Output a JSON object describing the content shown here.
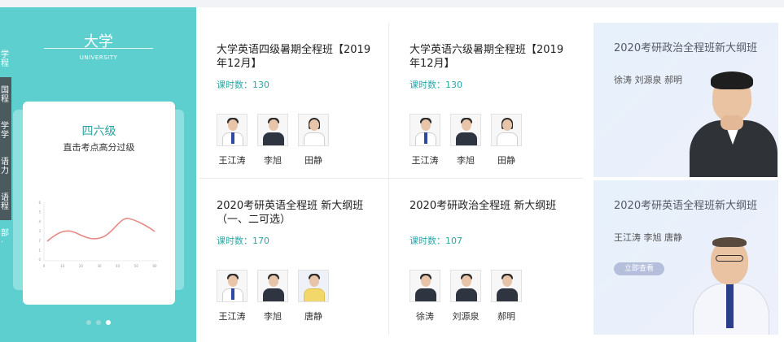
{
  "left_panel": {
    "title": "大学",
    "subtitle": "UNIVERSITY",
    "side_tabs": [
      "学程",
      "国程",
      "学学",
      "语力",
      "语程",
      "部·"
    ],
    "card": {
      "title": "四六级",
      "subtitle": "直击考点高分过级",
      "chart_ticks_x": [
        "0",
        "10",
        "20",
        "30",
        "40",
        "50",
        "60"
      ],
      "chart_ticks_y": [
        "6",
        "5",
        "4",
        "3",
        "2",
        "1",
        "0"
      ]
    },
    "carousel_dots": 3,
    "carousel_active": 3
  },
  "courses": [
    {
      "title": "大学英语四级暑期全程班【2019年12月】",
      "hours_label": "课时数：",
      "hours": "130",
      "teachers": [
        "王江涛",
        "李旭",
        "田静"
      ]
    },
    {
      "title": "大学英语六级暑期全程班【2019年12月】",
      "hours_label": "课时数：",
      "hours": "130",
      "teachers": [
        "王江涛",
        "李旭",
        "田静"
      ]
    },
    {
      "title": "2020考研英语全程班 新大纲班（一、二可选）",
      "hours_label": "课时数：",
      "hours": "170",
      "teachers": [
        "王江涛",
        "李旭",
        "唐静"
      ]
    },
    {
      "title": "2020考研政治全程班 新大纲班",
      "hours_label": "课时数：",
      "hours": "107",
      "teachers": [
        "徐涛",
        "刘源泉",
        "郝明"
      ]
    }
  ],
  "promos": [
    {
      "title": "2020考研政治全程班新大纲班",
      "teachers": "徐涛 刘源泉 郝明"
    },
    {
      "title": "2020考研英语全程班新大纲班",
      "teachers": "王江涛 李旭 唐静",
      "button": "立即查看"
    }
  ],
  "colors": {
    "teal": "#5dcfcf",
    "accent_text": "#2aa6a6",
    "sidetab_dark": "#4a5a5f",
    "promo_bg": "#e6f1fb"
  }
}
